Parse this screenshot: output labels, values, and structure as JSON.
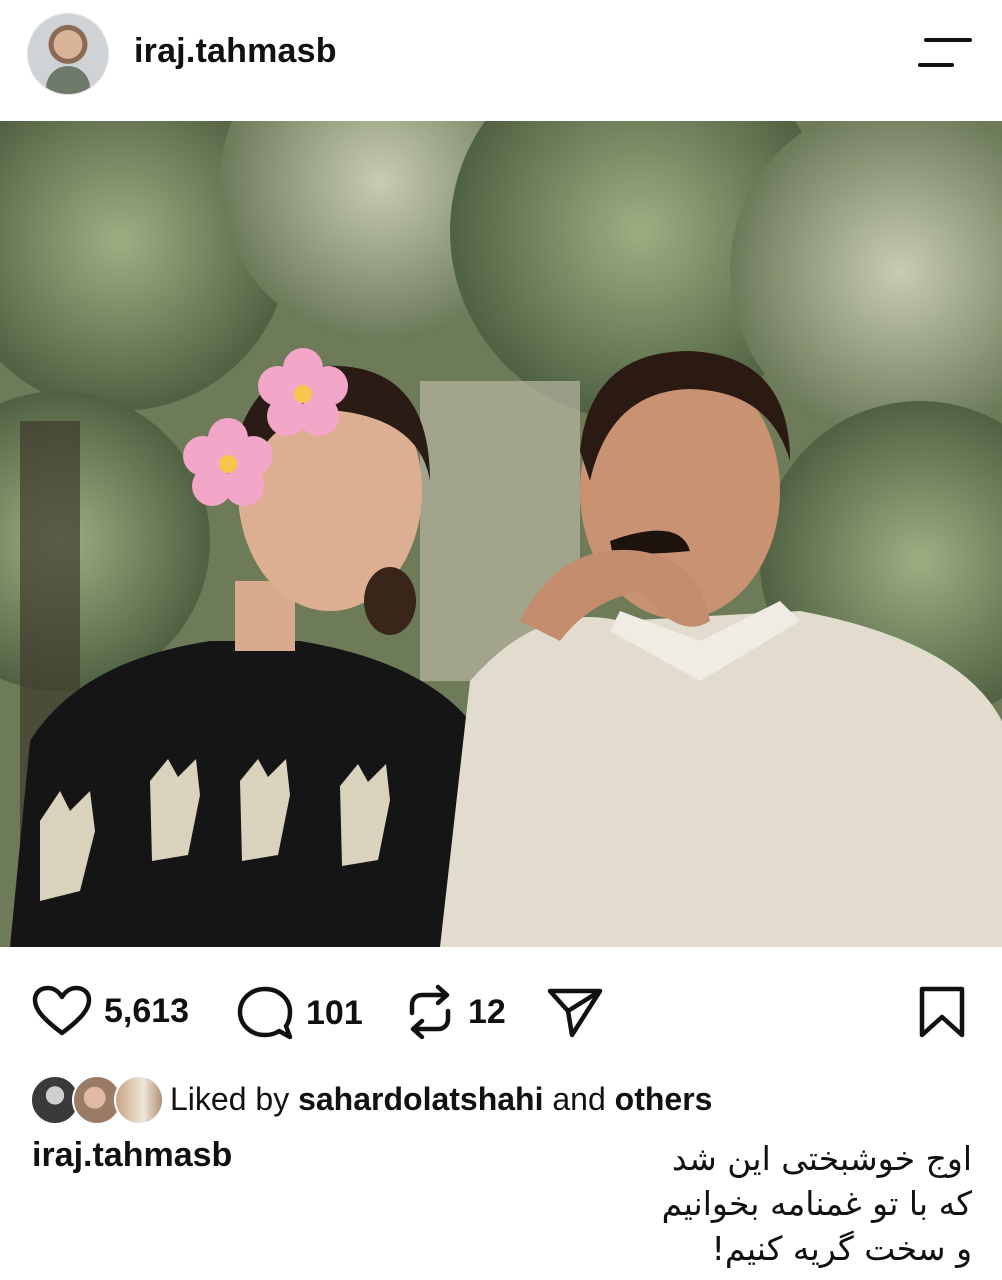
{
  "header": {
    "username": "iraj.tahmasb",
    "avatar_icon": "profile-avatar",
    "menu_icon": "hamburger-menu-icon"
  },
  "post_image": {
    "description_icon": "photo-two-people-sitting-under-trees"
  },
  "actions": {
    "likes": "5,613",
    "comments": "101",
    "reposts": "12",
    "icons": [
      "heart-icon",
      "comment-icon",
      "repost-icon",
      "share-icon",
      "bookmark-icon"
    ]
  },
  "liked_by": {
    "prefix": "Liked by",
    "user": "sahardolatshahi",
    "connector": "and",
    "others": "others"
  },
  "caption": {
    "username": "iraj.tahmasb",
    "lines": [
      "اوج خوشبختی این شد",
      "که با تو غمنامه بخوانیم",
      "و سخت گریه کنیم!"
    ]
  },
  "colors": {
    "text": "#111111",
    "background": "#ffffff"
  }
}
